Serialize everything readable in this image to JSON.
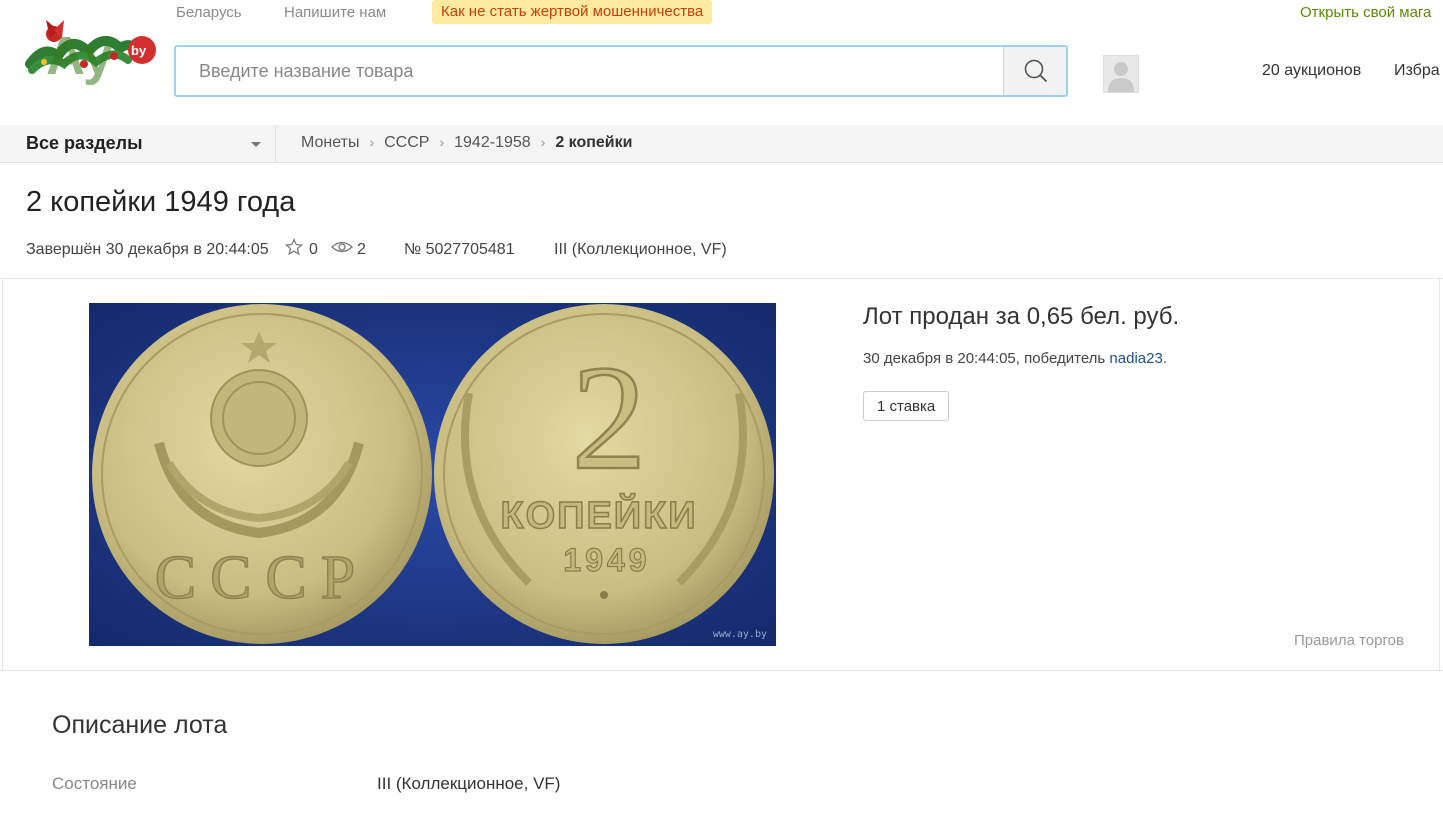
{
  "header": {
    "logo_text": "Ay.by",
    "top_links": {
      "region": "Беларусь",
      "contact": "Напишите нам",
      "fraud": "Как не стать жертвой мошенничества",
      "open_shop": "Открыть свой мага"
    },
    "search": {
      "placeholder": "Введите название товара",
      "button_icon": "search-icon"
    },
    "user": {
      "avatar_icon": "user-avatar-icon",
      "auctions": "20 аукционов",
      "favorites": "Избра"
    }
  },
  "nav": {
    "all_sections": "Все разделы",
    "breadcrumbs": [
      "Монеты",
      "СССР",
      "1942-1958",
      "2 копейки"
    ],
    "breadcrumb_separator": "›"
  },
  "lot": {
    "title": "2 копейки 1949 года",
    "finished": "Завершён 30 декабря в 20:44:05",
    "favorites_count": "0",
    "views_count": "2",
    "lot_number": "№ 5027705481",
    "condition_short": "III (Коллекционное, VF)",
    "photo": {
      "watermark": "www.ay.by",
      "obverse_text": "СССР",
      "reverse_denomination": "2",
      "reverse_word": "КОПЕЙКИ",
      "reverse_year": "1949"
    },
    "sold_text": "Лот продан за 0,65 бел. руб.",
    "winner_prefix": "30 декабря в 20:44:05, победитель ",
    "winner_name": "nadia23",
    "winner_suffix": ".",
    "bids_button": "1 ставка",
    "rules_link": "Правила торгов"
  },
  "description": {
    "title": "Описание лота",
    "condition_label": "Состояние",
    "condition_value": "III (Коллекционное, VF)"
  },
  "colors": {
    "fraud_bg": "#fdeaa0",
    "fraud_text": "#c2410c",
    "open_shop": "#5b8a00",
    "link": "#1d4f91",
    "search_border": "#9dd1f0",
    "photo_bg": "#1f3a8c"
  }
}
